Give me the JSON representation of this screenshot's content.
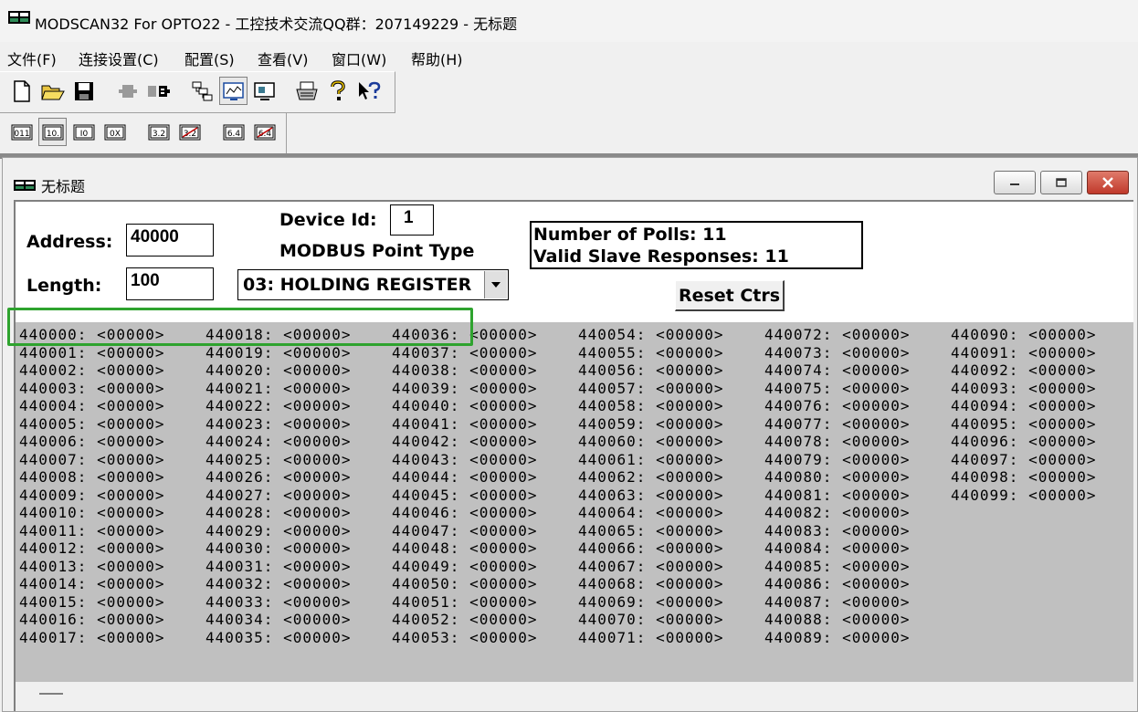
{
  "window": {
    "title": "MODSCAN32 For OPTO22 - 工控技术交流QQ群：207149229 - 无标题"
  },
  "menu": [
    "文件(F)",
    "连接设置(C)",
    "配置(S)",
    "查看(V)",
    "窗口(W)",
    "帮助(H)"
  ],
  "toolbar1": [
    "new-icon",
    "open-icon",
    "save-icon",
    "connect-icon",
    "disconnect-icon",
    "display-tree-icon",
    "display-graph-icon",
    "display-monitor-icon",
    "print-icon",
    "help-icon",
    "context-help-icon"
  ],
  "toolbar2": [
    "binary-icon",
    "decimal-icon",
    "integer-icon",
    "hex-icon",
    "float-icon",
    "float-swapped-icon",
    "double-icon",
    "double-swapped-icon"
  ],
  "child": {
    "title": "无标题",
    "address_label": "Address:",
    "address_value": "40000",
    "length_label": "Length:",
    "length_value": "100",
    "device_id_label": "Device Id:",
    "device_id_value": "1",
    "point_type_label": "MODBUS Point Type",
    "point_type_value": "03: HOLDING REGISTER",
    "polls_text": "Number of Polls: 11",
    "valid_text": "Valid Slave Responses: 11",
    "reset_label": "Reset Ctrs"
  },
  "registers": {
    "start": 440000,
    "count": 100,
    "per_column": 18,
    "value": "<00000>"
  }
}
